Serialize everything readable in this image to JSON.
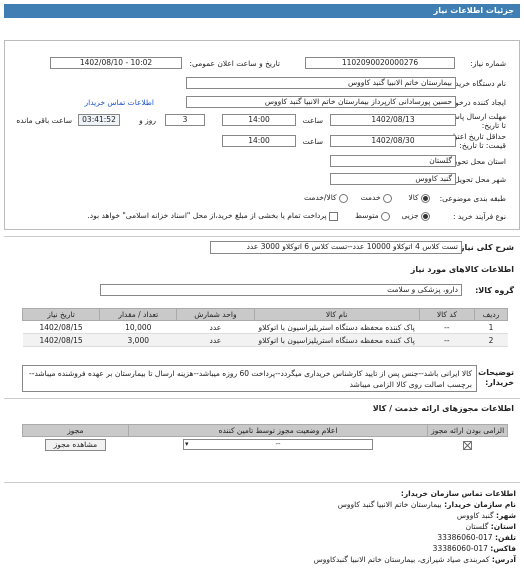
{
  "header": {
    "title": "جزئیات اطلاعات نیاز"
  },
  "form": {
    "need_number_label": "شماره نیاز:",
    "need_number": "1102090020000276",
    "announce_label": "تاریخ و ساعت اعلان عمومی:",
    "announce_value": "1402/08/10 - 10:02",
    "buyer_label": "نام دستگاه خریدار:",
    "buyer_value": "بیمارستان خاتم الانبیا گنبد کاووس",
    "creator_label": "ایجاد کننده درخواست:",
    "creator_value": "حسین پورسادانی کارپرداز بیمارستان خاتم الانبیا گنبد کاووس",
    "contact_link": "اطلاعات تماس خریدار",
    "deadline_label": "مهلت ارسال پاسخ: تا تاریخ:",
    "deadline_date": "1402/08/13",
    "time_label": "ساعت",
    "deadline_time": "14:00",
    "days_value": "3",
    "days_label": "روز و",
    "remaining_time": "03:41:52",
    "remaining_label": "ساعت باقی مانده",
    "validity_label": "حداقل تاریخ اعتبار قیمت: تا تاریخ:",
    "validity_date": "1402/08/30",
    "validity_time": "14:00",
    "province_label": "استان محل تحویل:",
    "province_value": "گلستان",
    "city_label": "شهر محل تحویل:",
    "city_value": "گنبد کاووس",
    "category_label": "طبقه بندی موضوعی:",
    "category_options": [
      "کالا",
      "خدمت",
      "کالا/خدمت"
    ],
    "purchase_label": "نوع فرآیند خرید :",
    "purchase_options": [
      "جزیی",
      "متوسط"
    ],
    "purchase_note": "پرداخت تمام یا بخشی از مبلغ خرید،از محل \"اسناد خزانه اسلامی\" خواهد بود."
  },
  "summary": {
    "label": "شرح کلی نیاز:",
    "value": "تست کلاس 4 اتوکلاو 10000 عدد--تست کلاس 6 اتوکلاو 3000 عدد"
  },
  "goods": {
    "section_title": "اطلاعات کالاهای مورد نیاز",
    "group_label": "گروه کالا:",
    "group_value": "دارو، پزشکی و سلامت",
    "columns": [
      "ردیف",
      "کد کالا",
      "نام کالا",
      "واحد شمارش",
      "تعداد / مقدار",
      "تاریخ نیاز"
    ],
    "rows": [
      [
        "1",
        "--",
        "پاک کننده محفظه دستگاه استریلیزاسیون با اتوکلاو",
        "عدد",
        "10,000",
        "1402/08/15"
      ],
      [
        "2",
        "--",
        "پاک کننده محفظه دستگاه استریلیزاسیون با اتوکلاو",
        "عدد",
        "3,000",
        "1402/08/15"
      ]
    ]
  },
  "buyer_notes": {
    "label": "توضیحات خریدار:",
    "value": "کالا ایرانی باشد--جنس پس از تایید کارشناس خریداری میگردد--پرداخت 60 روزه میباشد--هزینه ارسال تا بیمارستان بر عهده فروشنده میباشد--برچسب اصالت روی کالا الزامی میباشد"
  },
  "licenses": {
    "section_title": "اطلاعات مجوزهای ارائه خدمت / کالا",
    "columns": [
      "الزامی بودن ارائه مجوز",
      "اعلام وضعیت مجوز توسط تامین کننده",
      "مجوز"
    ],
    "row_select": "--",
    "view_button": "مشاهده مجوز"
  },
  "org_contact": {
    "title": "اطلاعات تماس سازمان خریدار:",
    "lines": [
      {
        "k": "نام سازمان خریدار:",
        "v": "بیمارستان خاتم الانبیا گنبد کاووس"
      },
      {
        "k": "شهر:",
        "v": "گنبد کاووس"
      },
      {
        "k": "استان:",
        "v": "گلستان"
      },
      {
        "k": "تلفن:",
        "v": "017-33386060"
      },
      {
        "k": "فاکس:",
        "v": "017-33386060"
      },
      {
        "k": "آدرس:",
        "v": "کمربندی صیاد شیرازی، بیمارستان خاتم الانبیا گنبدکاووس"
      }
    ]
  }
}
